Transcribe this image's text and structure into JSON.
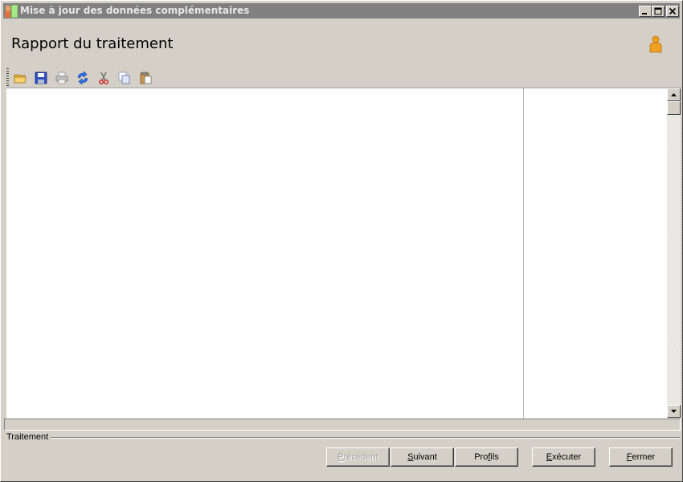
{
  "window": {
    "title": "Mise à jour des données complémentaires",
    "controls": [
      "minimize",
      "maximize",
      "close"
    ]
  },
  "header": {
    "title": "Rapport du traitement",
    "icon": "user-icon"
  },
  "toolbar": {
    "items": [
      {
        "name": "open",
        "icon": "folder-icon"
      },
      {
        "name": "save",
        "icon": "floppy-icon"
      },
      {
        "name": "print",
        "icon": "printer-icon",
        "disabled": true
      },
      {
        "name": "refresh",
        "icon": "refresh-icon"
      },
      {
        "name": "cut",
        "icon": "scissors-icon"
      },
      {
        "name": "copy",
        "icon": "copy-icon"
      },
      {
        "name": "paste",
        "icon": "paste-icon"
      }
    ]
  },
  "group": {
    "label": "Traitement"
  },
  "buttons": {
    "previous": {
      "label_first": "P",
      "label_rest": "récédent",
      "disabled": true
    },
    "next": {
      "label_first": "S",
      "label_rest": "uivant"
    },
    "profiles": {
      "label_before": "Pro",
      "label_ul": "f",
      "label_after": "ils"
    },
    "execute": {
      "label_first": "E",
      "label_rest": "xécuter"
    },
    "close": {
      "label_first": "F",
      "label_rest": "ermer"
    }
  }
}
